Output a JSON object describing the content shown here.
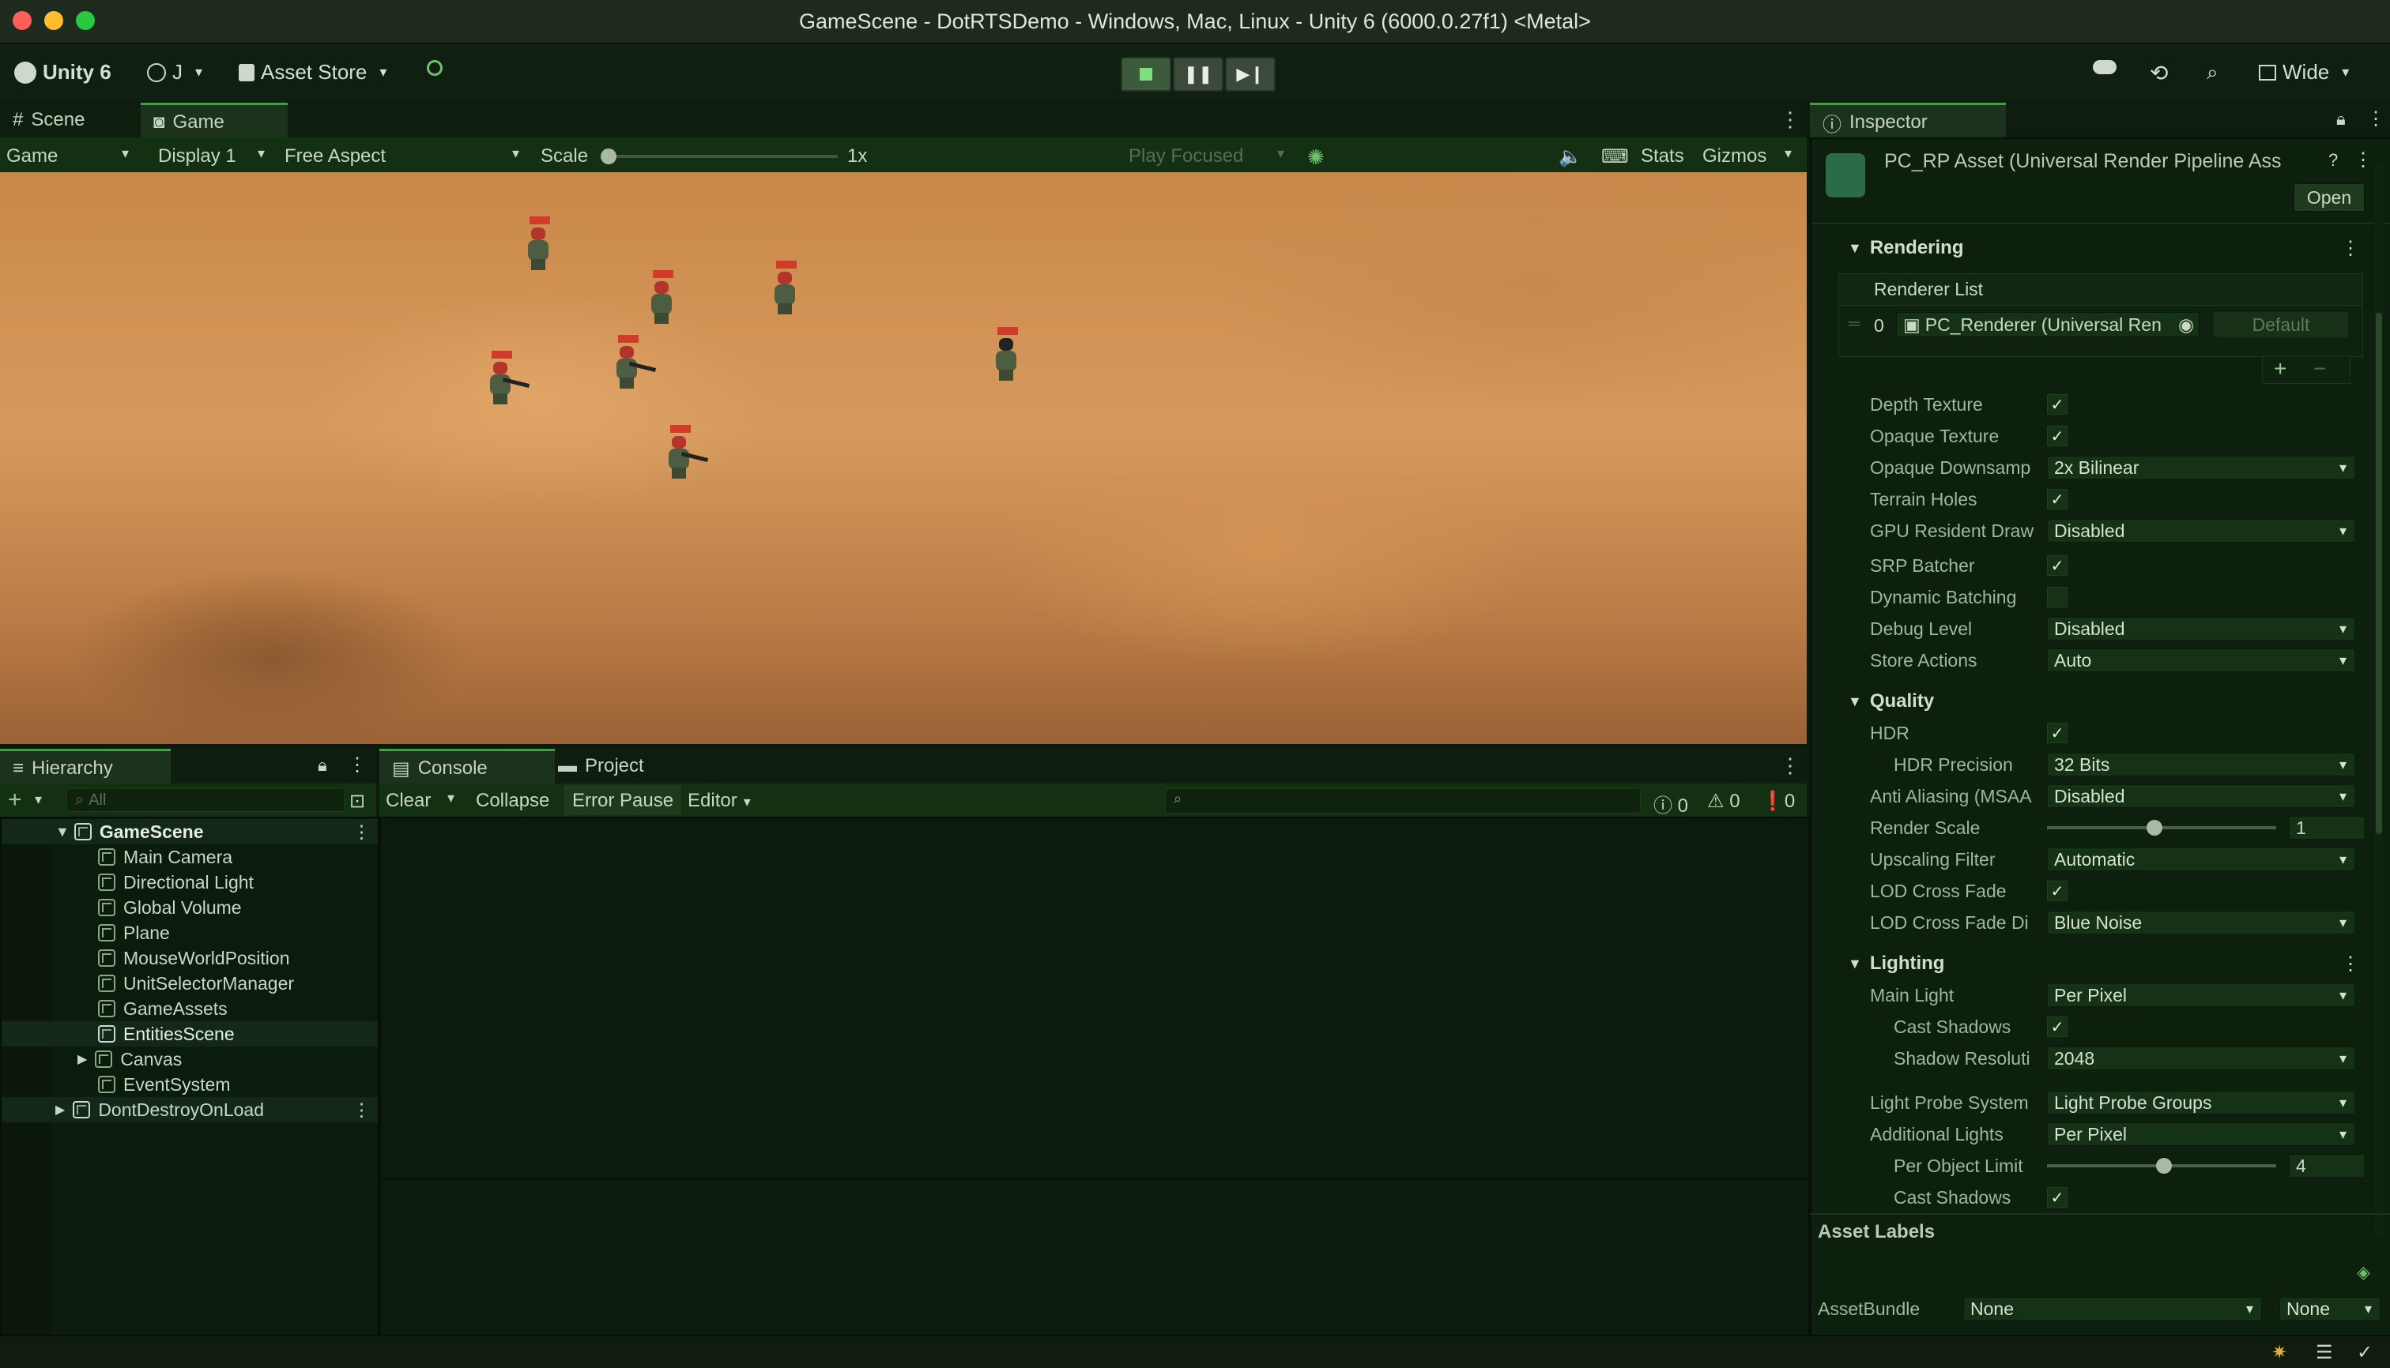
{
  "window": {
    "title": "GameScene - DotRTSDemo - Windows, Mac, Linux - Unity 6 (6000.0.27f1) <Metal>"
  },
  "toolbar": {
    "unity_label": "Unity 6",
    "account_label": "J",
    "asset_store_label": "Asset Store",
    "layout_label": "Wide"
  },
  "game_view": {
    "tabs": [
      "Scene",
      "Game"
    ],
    "mode": "Game",
    "display": "Display 1",
    "aspect": "Free Aspect",
    "scale_label": "Scale",
    "scale_value": "1x",
    "play_focused": "Play Focused",
    "stats": "Stats",
    "gizmos": "Gizmos"
  },
  "hierarchy": {
    "tab": "Hierarchy",
    "search_placeholder": "All",
    "items": [
      {
        "label": "GameScene"
      },
      {
        "label": "Main Camera"
      },
      {
        "label": "Directional Light"
      },
      {
        "label": "Global Volume"
      },
      {
        "label": "Plane"
      },
      {
        "label": "MouseWorldPosition"
      },
      {
        "label": "UnitSelectorManager"
      },
      {
        "label": "GameAssets"
      },
      {
        "label": "EntitiesScene"
      },
      {
        "label": "Canvas"
      },
      {
        "label": "EventSystem"
      },
      {
        "label": "DontDestroyOnLoad"
      }
    ]
  },
  "console": {
    "tabs": [
      "Console",
      "Project"
    ],
    "clear": "Clear",
    "collapse": "Collapse",
    "error_pause": "Error Pause",
    "editor": "Editor",
    "count_info": "0",
    "count_warn": "0",
    "count_error": "0"
  },
  "inspector": {
    "tab": "Inspector",
    "asset_title": "PC_RP Asset (Universal Render Pipeline Ass",
    "open_button": "Open",
    "rendering_section": "Rendering",
    "renderer_list_label": "Renderer List",
    "renderer_index": "0",
    "renderer_name": "PC_Renderer (Universal Ren",
    "renderer_default": "Default",
    "rows_rendering": [
      {
        "label": "Depth Texture",
        "type": "check",
        "value": "✓"
      },
      {
        "label": "Opaque Texture",
        "type": "check",
        "value": "✓"
      },
      {
        "label": "Opaque Downsamp",
        "type": "dropdown",
        "value": "2x Bilinear"
      },
      {
        "label": "Terrain Holes",
        "type": "check",
        "value": "✓"
      },
      {
        "label": "GPU Resident Draw",
        "type": "dropdown",
        "value": "Disabled"
      },
      {
        "label": "SRP Batcher",
        "type": "check",
        "value": "✓"
      },
      {
        "label": "Dynamic Batching",
        "type": "check",
        "value": ""
      },
      {
        "label": "Debug Level",
        "type": "dropdown",
        "value": "Disabled"
      },
      {
        "label": "Store Actions",
        "type": "dropdown",
        "value": "Auto"
      }
    ],
    "quality_section": "Quality",
    "hdr_label": "HDR",
    "hdr_value": "✓",
    "hdr_precision_label": "HDR Precision",
    "hdr_precision_value": "32 Bits",
    "anti_aliasing_label": "Anti Aliasing (MSAA",
    "anti_aliasing_value": "Disabled",
    "render_scale_label": "Render Scale",
    "render_scale_value": "1",
    "upscaling_label": "Upscaling Filter",
    "upscaling_value": "Automatic",
    "lod_cross_fade_label": "LOD Cross Fade",
    "lod_cross_fade_value": "✓",
    "lod_cross_fade_di_label": "LOD Cross Fade Di",
    "lod_cross_fade_di_value": "Blue Noise",
    "lighting_section": "Lighting",
    "main_light_label": "Main Light",
    "main_light_value": "Per Pixel",
    "cast_shadows_label": "Cast Shadows",
    "cast_shadows_value": "✓",
    "shadow_res_label": "Shadow Resoluti",
    "shadow_res_value": "2048",
    "light_probe_label": "Light Probe System",
    "light_probe_value": "Light Probe Groups",
    "additional_lights_label": "Additional Lights",
    "additional_lights_value": "Per Pixel",
    "per_object_limit_label": "Per Object Limit",
    "per_object_limit_value": "4",
    "cast_shadows2_label": "Cast Shadows",
    "cast_shadows2_value": "✓",
    "asset_labels": "Asset Labels",
    "asset_bundle_label": "AssetBundle",
    "asset_bundle_value": "None",
    "asset_bundle_variant": "None"
  },
  "colors": {
    "ground_light": "#d9985a",
    "ground_dark": "#8a5a30",
    "panel_bg": "#0c1c0c",
    "accent": "#4a9a4a"
  }
}
